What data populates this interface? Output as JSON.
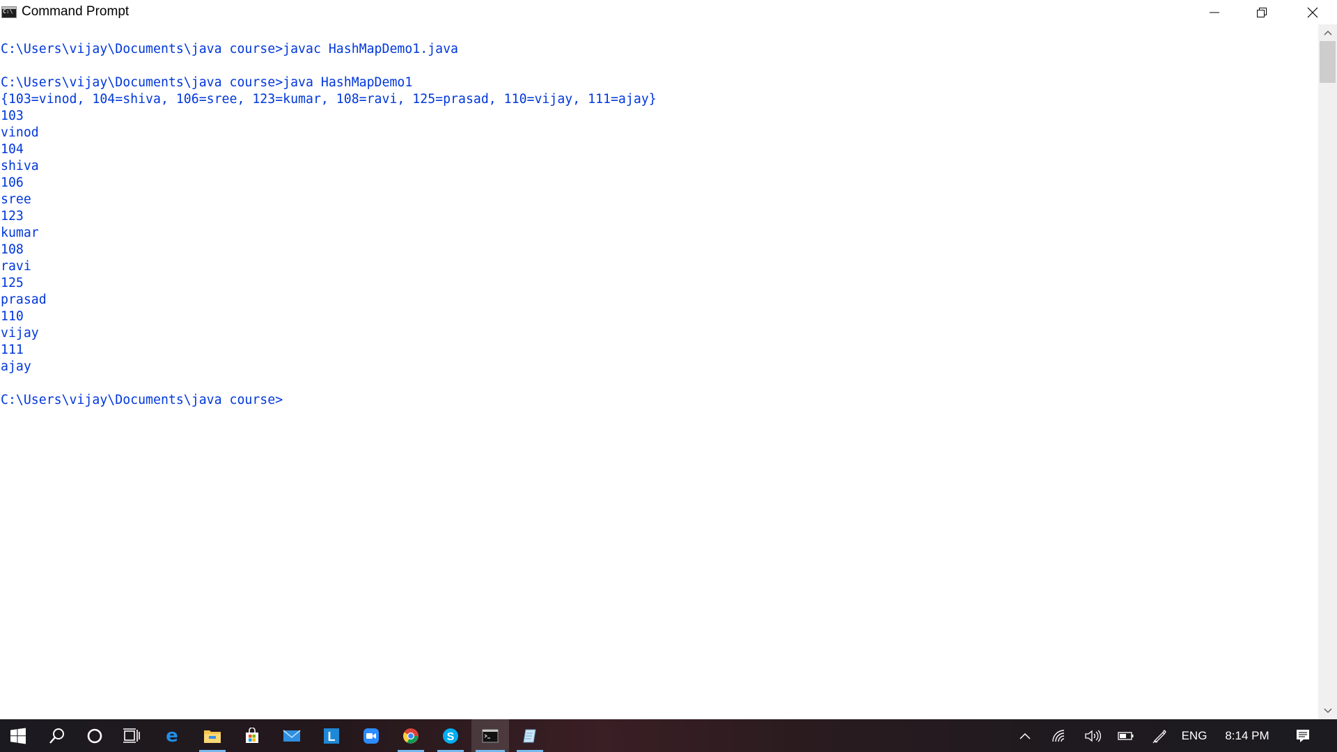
{
  "window": {
    "title": "Command Prompt",
    "icon": "console-app-icon",
    "controls": [
      "minimize-icon",
      "restore-icon",
      "close-icon"
    ]
  },
  "console": {
    "text_color": "#0037da",
    "background": "#ffffff",
    "lines": [
      "",
      "C:\\Users\\vijay\\Documents\\java course>javac HashMapDemo1.java",
      "",
      "C:\\Users\\vijay\\Documents\\java course>java HashMapDemo1",
      "{103=vinod, 104=shiva, 106=sree, 123=kumar, 108=ravi, 125=prasad, 110=vijay, 111=ajay}",
      "103",
      "vinod",
      "104",
      "shiva",
      "106",
      "sree",
      "123",
      "kumar",
      "108",
      "ravi",
      "125",
      "prasad",
      "110",
      "vijay",
      "111",
      "ajay",
      "",
      "C:\\Users\\vijay\\Documents\\java course>"
    ]
  },
  "taskbar": {
    "apps": [
      "windows-start-icon",
      "search-icon",
      "cortana-icon",
      "task-view-icon",
      "edge-icon",
      "file-explorer-icon",
      "microsoft-store-icon",
      "mail-icon",
      "l-app-icon",
      "zoom-icon",
      "chrome-icon",
      "skype-icon",
      "command-prompt-icon",
      "notepad-icon"
    ],
    "tray": {
      "icons": [
        "show-hidden-icons-chevron",
        "wifi-icon",
        "volume-icon",
        "battery-icon",
        "pen-icon"
      ],
      "language": "ENG",
      "time": "8:14 PM",
      "notification_icon": "action-center-icon"
    }
  }
}
